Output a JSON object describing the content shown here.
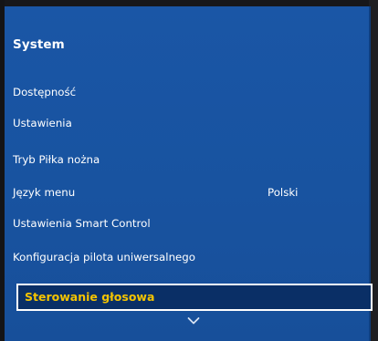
{
  "menu": {
    "title": "System",
    "items": [
      {
        "label": "Dostępność"
      },
      {
        "label": "Ustawienia"
      },
      {
        "label": "Tryb Piłka nożna"
      },
      {
        "label": "Język menu",
        "value": "Polski"
      },
      {
        "label": "Ustawienia Smart Control"
      },
      {
        "label": "Konfiguracja pilota uniwersalnego"
      },
      {
        "label": "Sterowanie głosowa",
        "selected": true
      }
    ]
  },
  "icons": {
    "scroll_down": "chevron-down-icon"
  },
  "colors": {
    "panel_background": "#1a56a6",
    "selected_background": "#0a2f66",
    "selected_text": "#f5c400",
    "text": "#ffffff"
  }
}
